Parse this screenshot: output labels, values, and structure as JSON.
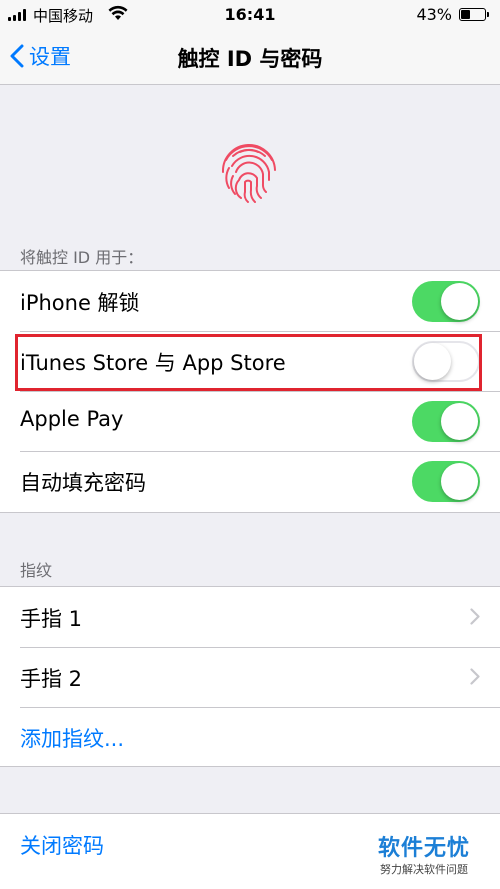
{
  "status_bar": {
    "carrier": "中国移动",
    "time": "16:41",
    "battery_percent_text": "43%",
    "battery_level": 0.43
  },
  "nav": {
    "back_label": "设置",
    "title": "触控 ID 与密码"
  },
  "touch_id_section": {
    "header": "将触控 ID 用于：",
    "items": [
      {
        "label": "iPhone 解锁",
        "on": true
      },
      {
        "label": "iTunes Store 与 App Store",
        "on": false
      },
      {
        "label": "Apple Pay",
        "on": true
      },
      {
        "label": "自动填充密码",
        "on": true
      }
    ]
  },
  "fingerprints_section": {
    "header": "指纹",
    "items": [
      {
        "label": "手指 1"
      },
      {
        "label": "手指 2"
      }
    ],
    "add_label": "添加指纹..."
  },
  "passcode": {
    "turn_off_label": "关闭密码"
  },
  "watermark": {
    "title": "软件无忧",
    "subtitle": "努力解决软件问题"
  },
  "colors": {
    "accent": "#007aff",
    "toggle_on": "#4cd964",
    "highlight": "#e0242f",
    "fingerprint": "#ef4b63"
  },
  "icons": {
    "back": "chevron-left-icon",
    "fingerprint": "fingerprint-icon",
    "disclosure": "chevron-right-icon",
    "wifi": "wifi-icon",
    "battery": "battery-icon",
    "signal": "signal-icon"
  }
}
